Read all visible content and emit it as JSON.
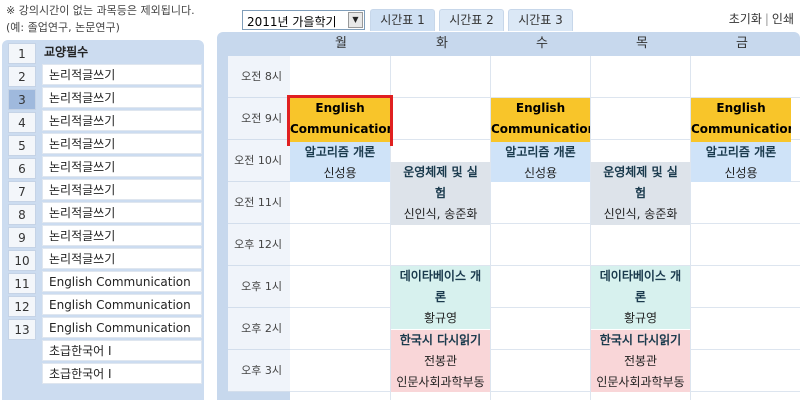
{
  "note": "※ 강의시간이 없는 과목등은 제외됩니다. (예: 졸업연구, 논문연구)",
  "semester_select": {
    "value": "2011년 가을학기"
  },
  "tabs": [
    {
      "label": "시간표 1"
    },
    {
      "label": "시간표 2"
    },
    {
      "label": "시간표 3"
    }
  ],
  "links": {
    "reset": "초기화",
    "print": "인쇄"
  },
  "list": {
    "header": "교양필수",
    "numbers": [
      "1",
      "2",
      "3",
      "4",
      "5",
      "6",
      "7",
      "8",
      "9",
      "10",
      "11",
      "12",
      "13"
    ],
    "selected_number": "3",
    "courses": [
      "논리적글쓰기",
      "논리적글쓰기",
      "논리적글쓰기",
      "논리적글쓰기",
      "논리적글쓰기",
      "논리적글쓰기",
      "논리적글쓰기",
      "논리적글쓰기",
      "논리적글쓰기",
      "English Communication",
      "English Communication",
      "English Communication",
      "초급한국어 I",
      "초급한국어 I"
    ]
  },
  "timetable": {
    "days": [
      "월",
      "화",
      "수",
      "목",
      "금"
    ],
    "times": [
      "오전 8시",
      "오전 9시",
      "오전 10시",
      "오전 11시",
      "오후 12시",
      "오후 1시",
      "오후 2시",
      "오후 3시"
    ],
    "blocks": {
      "eng": {
        "line1": "English",
        "line2": "Communication"
      },
      "algo": {
        "title": "알고리즘 개론",
        "prof": "신성용"
      },
      "os": {
        "line1": "운영체제 및 실",
        "line2": "험",
        "prof": "신인식, 송준화"
      },
      "db": {
        "line1": "데이타베이스 개",
        "line2": "론",
        "prof": "황규영"
      },
      "kor": {
        "title": "한국시 다시읽기",
        "prof": "전봉관",
        "room": "인문사회과학부동"
      }
    }
  }
}
